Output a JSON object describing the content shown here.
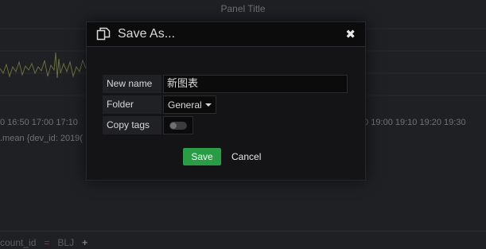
{
  "background": {
    "panel_title": "Panel Title",
    "time_ticks_left": "0 16:50 17:00 17:10",
    "time_ticks_right": "50 19:00 19:10 19:20 19:30",
    "legend_text": ".mean {dev_id: 2019(",
    "bottom_bar": {
      "var_name": "count_id",
      "operator": "=",
      "var_value": "BLJ",
      "add_symbol": "+"
    }
  },
  "dialog": {
    "title": "Save As...",
    "close_symbol": "✖",
    "fields": {
      "name_label": "New name",
      "name_value": "新图表",
      "folder_label": "Folder",
      "folder_value": "General",
      "copy_tags_label": "Copy tags",
      "copy_tags_on": false
    },
    "save_label": "Save",
    "cancel_label": "Cancel"
  },
  "colors": {
    "save": "#299c46",
    "background": "#1f2024",
    "modal": "#141416"
  }
}
